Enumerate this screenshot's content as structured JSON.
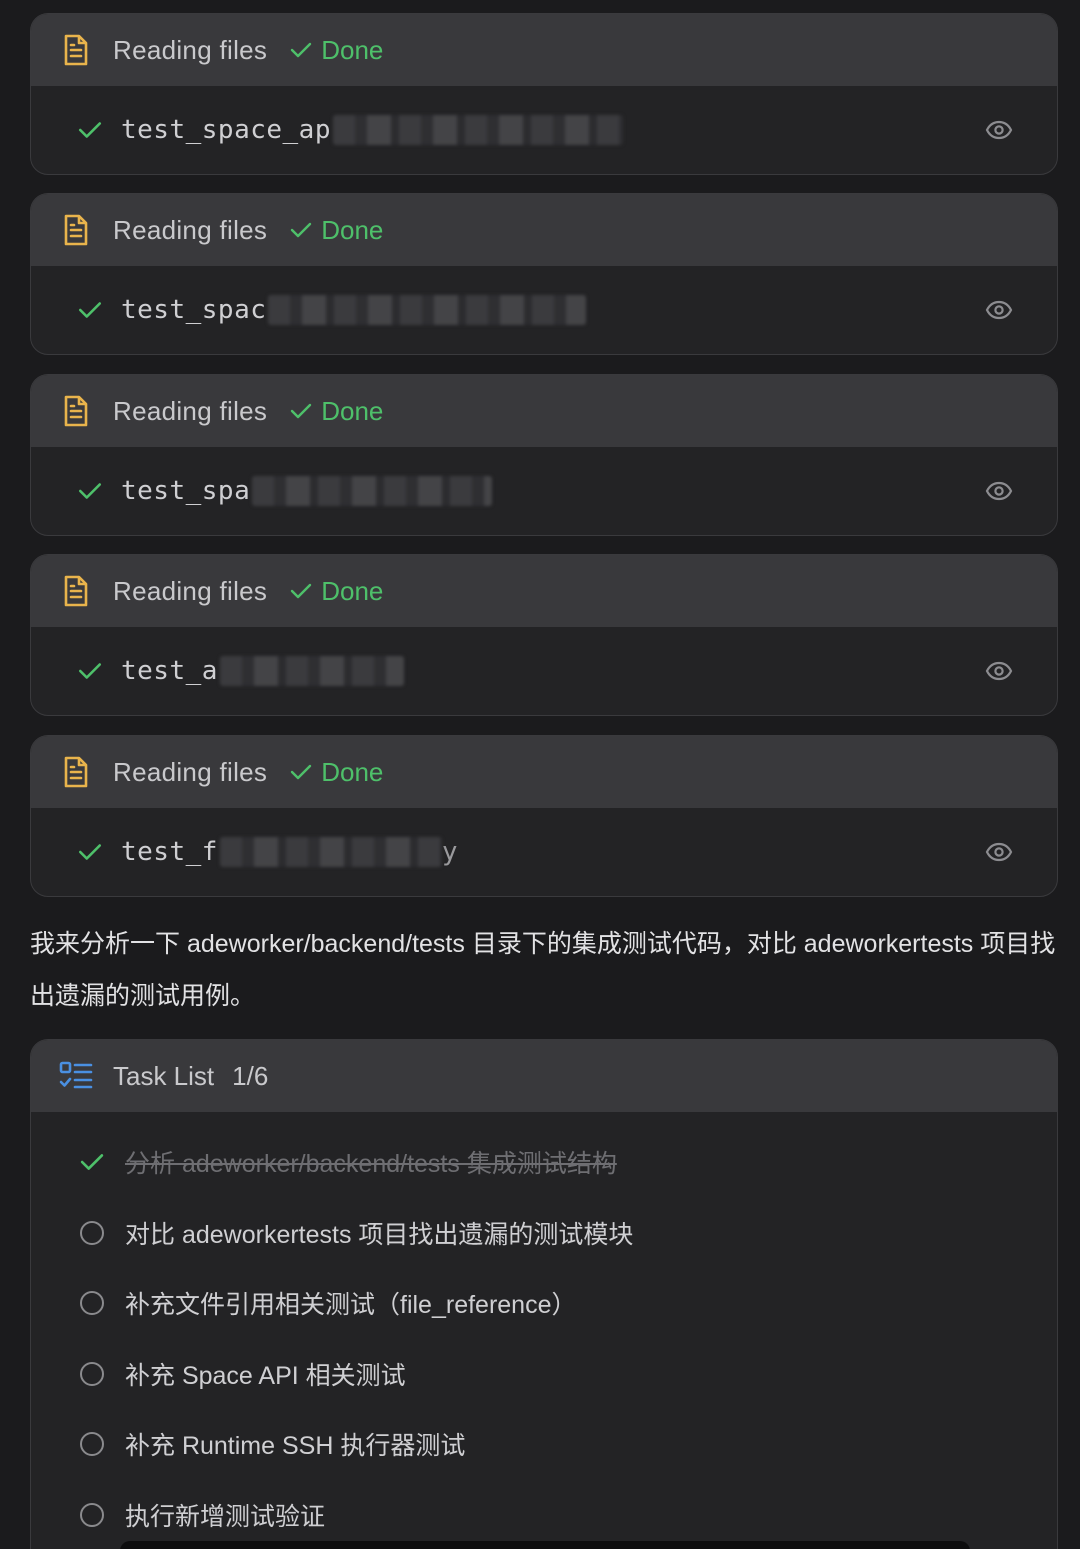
{
  "colors": {
    "accent_green": "#4ec06a",
    "file_icon": "#e9b44c",
    "task_icon": "#4a90e2",
    "header_bg": "#39393c",
    "body_bg": "#232325"
  },
  "file_cards": [
    {
      "title": "Reading files",
      "status": "Done",
      "filename": "test_space_ap",
      "tail": ""
    },
    {
      "title": "Reading files",
      "status": "Done",
      "filename": "test_spac",
      "tail": ""
    },
    {
      "title": "Reading files",
      "status": "Done",
      "filename": "test_spa",
      "tail": ""
    },
    {
      "title": "Reading files",
      "status": "Done",
      "filename": "test_a",
      "tail": ""
    },
    {
      "title": "Reading files",
      "status": "Done",
      "filename": "test_f",
      "tail": "y"
    }
  ],
  "message": {
    "text": "我来分析一下 adeworker/backend/tests 目录下的集成测试代码，对比 adeworkertests 项目找出遗漏的测试用例。"
  },
  "task_list": {
    "title": "Task List",
    "count": "1/6",
    "items": [
      {
        "label": "分析 adeworker/backend/tests 集成测试结构",
        "completed": true
      },
      {
        "label": "对比 adeworkertests 项目找出遗漏的测试模块",
        "completed": false
      },
      {
        "label": "补充文件引用相关测试（file_reference）",
        "completed": false
      },
      {
        "label": "补充 Space API 相关测试",
        "completed": false
      },
      {
        "label": "补充 Runtime SSH 执行器测试",
        "completed": false
      },
      {
        "label": "执行新增测试验证",
        "completed": false
      }
    ]
  },
  "icons": {
    "file": "file-text-icon",
    "status": "check-icon",
    "preview": "eye-icon",
    "task": "task-list-icon",
    "todo": "circle-icon"
  }
}
